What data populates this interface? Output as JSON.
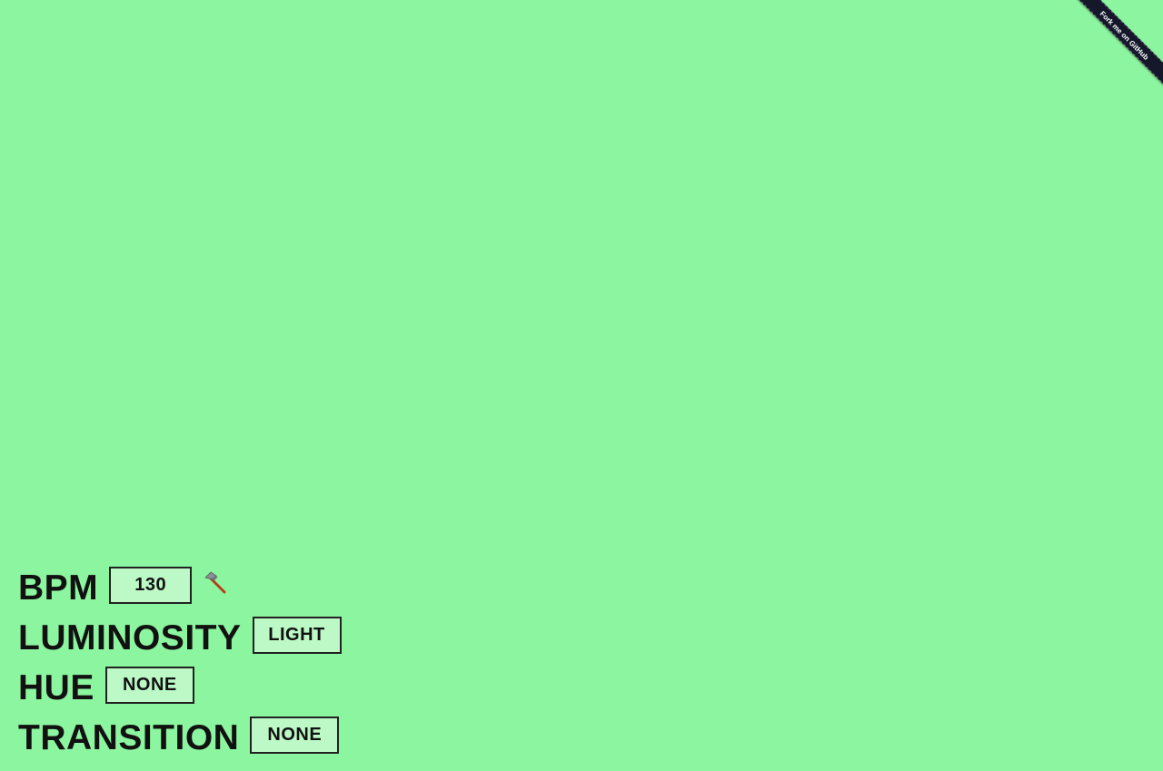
{
  "ribbon": {
    "label": "Fork me on GitHub"
  },
  "controls": {
    "bpm": {
      "label": "BPM",
      "value": "130",
      "tap_icon": "hammer-icon"
    },
    "luminosity": {
      "label": "LUMINOSITY",
      "value": "LIGHT"
    },
    "hue": {
      "label": "HUE",
      "value": "NONE"
    },
    "transition": {
      "label": "TRANSITION",
      "value": "NONE"
    }
  },
  "colors": {
    "background": "#8cf59f",
    "box_fill": "#bcf9c6",
    "ribbon": "#14182a",
    "text": "#111111"
  }
}
